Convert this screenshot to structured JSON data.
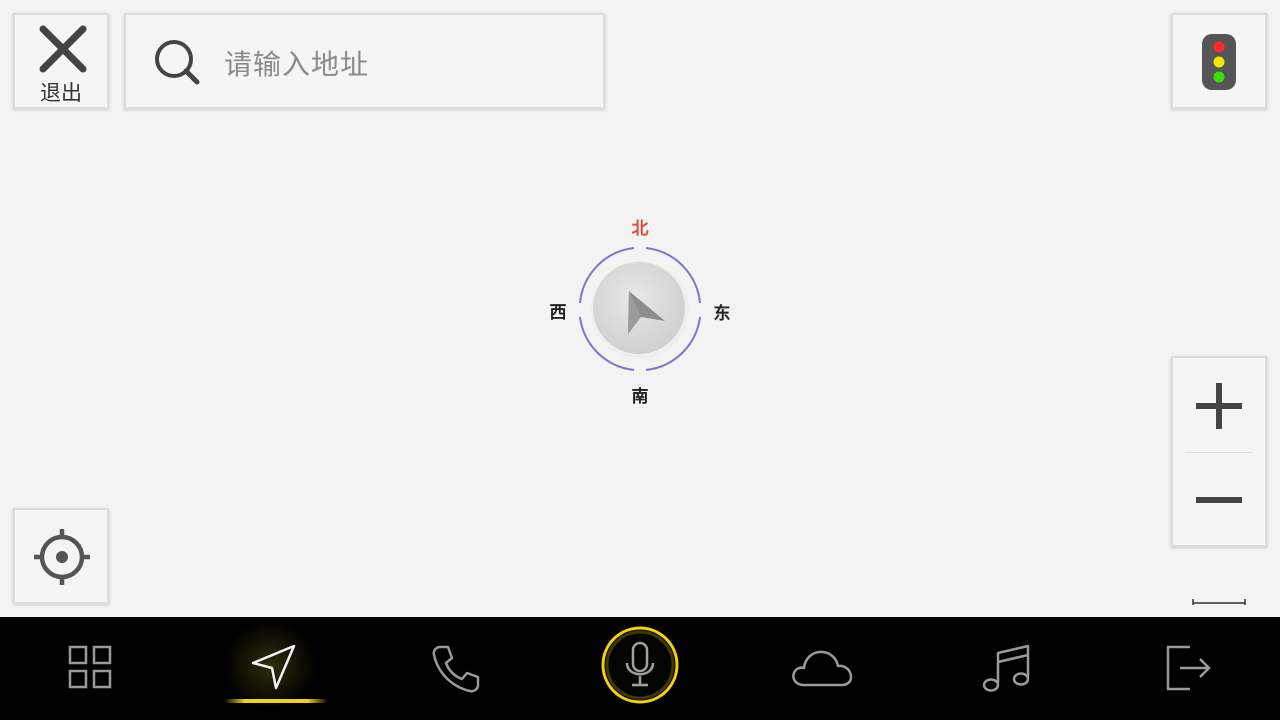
{
  "topbar": {
    "exit_label": "退出",
    "search_placeholder": "请输入地址"
  },
  "compass": {
    "north": "北",
    "south": "南",
    "east": "东",
    "west": "西"
  },
  "icons": {
    "exit": "close-icon",
    "search": "search-icon",
    "traffic": "traffic-light-icon",
    "locate": "crosshair-icon",
    "zoom_in": "plus-icon",
    "zoom_out": "minus-icon",
    "heading": "navigation-arrow-icon"
  },
  "bottom_nav": {
    "items": [
      {
        "icon": "apps-grid-icon",
        "active": false
      },
      {
        "icon": "navigation-icon",
        "active": true
      },
      {
        "icon": "phone-icon",
        "active": false
      },
      {
        "icon": "microphone-icon",
        "active": false
      },
      {
        "icon": "cloud-icon",
        "active": false
      },
      {
        "icon": "music-icon",
        "active": false
      },
      {
        "icon": "logout-icon",
        "active": false
      }
    ]
  },
  "colors": {
    "accent": "#f5d20b",
    "north": "#e04a3a",
    "compass_ring": "#7b77c9",
    "bar_background": "#000000",
    "map_background": "#f3f3f3"
  }
}
